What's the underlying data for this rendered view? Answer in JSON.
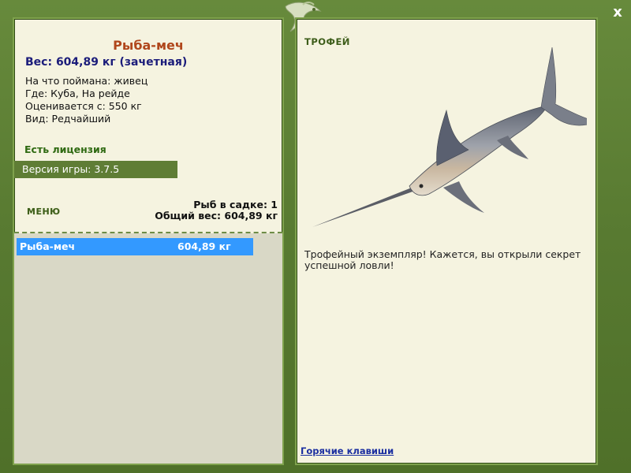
{
  "window": {
    "close_label": "x"
  },
  "fish": {
    "title": "Рыба-меч",
    "weight_line": "Вес: 604,89 кг (зачетная)",
    "caught_on": "На что поймана: живец",
    "where": "Где: Куба, На рейде",
    "valued_from": "Оценивается с: 550 кг",
    "kind": "Вид: Редчайший"
  },
  "license": "Есть лицензия",
  "version": "Версия игры: 3.7.5",
  "menu_label": "МЕНЮ",
  "summary": {
    "count": "Рыб в садке: 1",
    "total": "Общий вес: 604,89 кг"
  },
  "catch_list": [
    {
      "name": "Рыба-меч",
      "weight": "604,89 кг"
    }
  ],
  "trophy": {
    "label": "ТРОФЕЙ",
    "text": "Трофейный экземпляр! Кажется, вы открыли секрет успешной ловли!"
  },
  "hotkeys": "Горячие клавиши",
  "colors": {
    "frame_green": "#5a7d33",
    "panel_bg": "#f5f3e0",
    "title_orange": "#b0471c",
    "weight_blue": "#1b1c7a",
    "selection_blue": "#3399ff"
  }
}
